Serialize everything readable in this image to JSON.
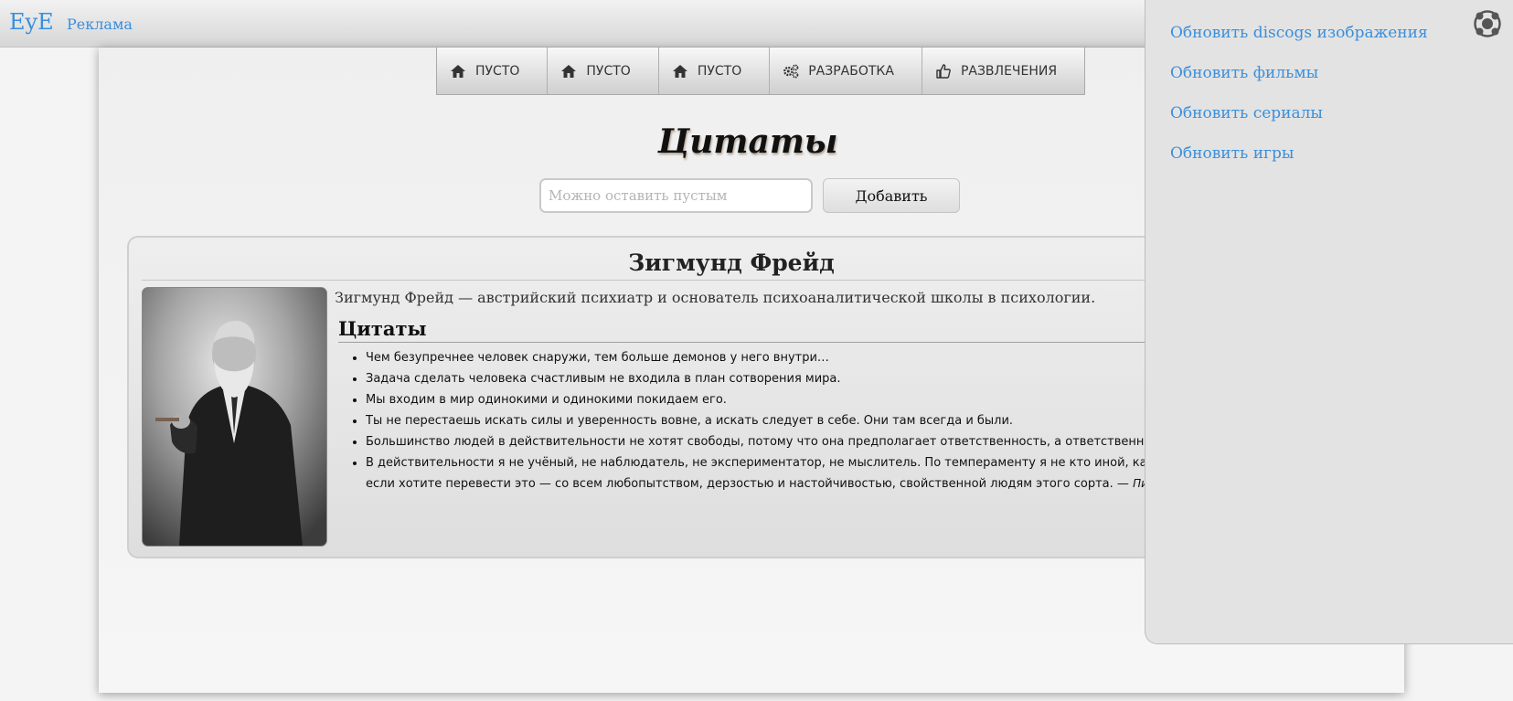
{
  "topbar": {
    "brand": "EyE",
    "ads_link": "Реклама"
  },
  "nav": [
    {
      "label": "ПУСТО",
      "icon": "home-icon"
    },
    {
      "label": "ПУСТО",
      "icon": "home-icon"
    },
    {
      "label": "ПУСТО",
      "icon": "home-icon"
    },
    {
      "label": "РАЗРАБОТКА",
      "icon": "gears-icon"
    },
    {
      "label": "РАЗВЛЕЧЕНИЯ",
      "icon": "thumbs-up-icon"
    }
  ],
  "main": {
    "title": "Цитаты",
    "input_placeholder": "Можно оставить пустым",
    "add_button": "Добавить"
  },
  "card": {
    "name": "Зигмунд Фрейд",
    "description": "Зигмунд Фрейд — австрийский психиатр и основатель психоаналитической школы в психологии.",
    "quotes_heading": "Цитаты",
    "quotes": [
      "Чем безупречнее человек снаружи, тем больше демонов у него внутри…",
      "Задача сделать человека счастливым не входила в план сотворения мира.",
      "Мы входим в мир одинокими и одинокими покидаем его.",
      "Ты не перестаешь искать силы и уверенность вовне, а искать следует в себе. Они там всегда и были.",
      "Большинство людей в действительности не хотят свободы, потому что она предполагает ответственность, а ответственность боль",
      "В действительности я не учёный, не наблюдатель, не экспериментатор, не мыслитель. По темпераменту я не кто иной, как конкис"
    ],
    "last_quote_line2": "если хотите перевести это — со всем любопытством, дерзостью и настойчивостью, свойственной людям этого сорта. —",
    "last_quote_source": "Письмо Ви"
  },
  "sidepanel": {
    "links": [
      "Обновить discogs изображения",
      "Обновить фильмы",
      "Обновить сериалы",
      "Обновить игры"
    ],
    "close_icon": "close-icon"
  },
  "colors": {
    "link": "#3a8fdc",
    "panel": "#e3e3e3"
  }
}
